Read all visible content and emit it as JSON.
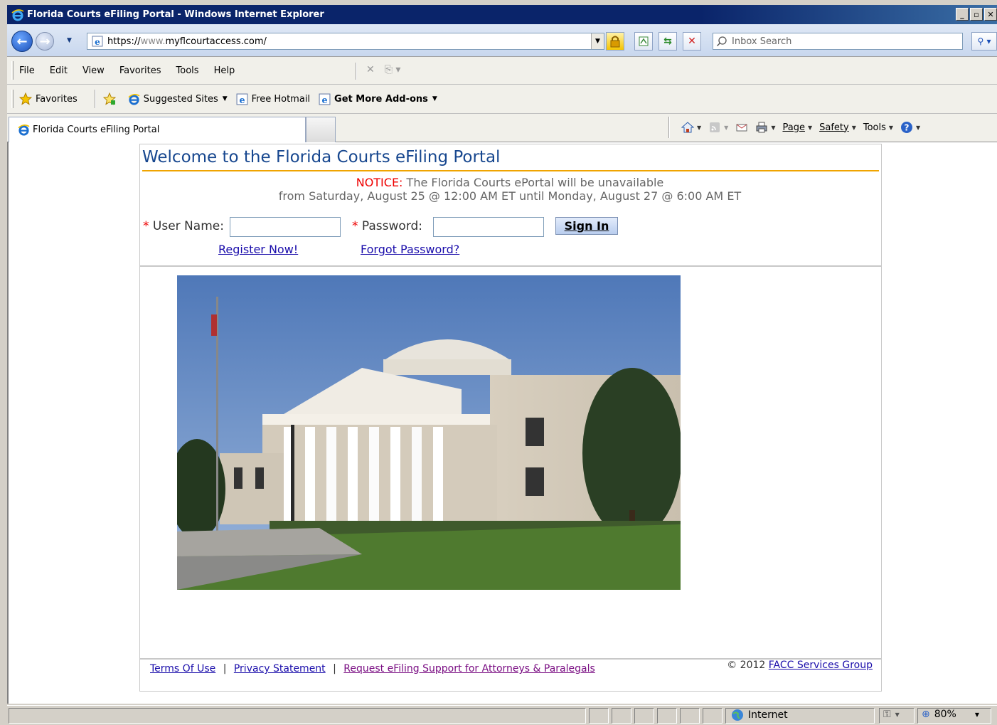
{
  "window": {
    "title": "Florida Courts eFiling Portal - Windows Internet Explorer"
  },
  "address": {
    "url_scheme": "https://",
    "url_host": "www.",
    "url_domain": "myflcourtaccess.com/",
    "search_placeholder": "Inbox Search"
  },
  "menu": {
    "items": [
      "File",
      "Edit",
      "View",
      "Favorites",
      "Tools",
      "Help"
    ]
  },
  "favorites": {
    "favorites_label": "Favorites",
    "suggested_sites": "Suggested Sites",
    "free_hotmail": "Free Hotmail",
    "get_addons": "Get More Add-ons"
  },
  "tab": {
    "label": "Florida Courts eFiling Portal"
  },
  "command_bar": {
    "page": "Page",
    "safety": "Safety",
    "tools": "Tools"
  },
  "page": {
    "title": "Welcome to the Florida Courts eFiling Portal",
    "notice_label": "NOTICE:",
    "notice_line1": "The Florida Courts ePortal will be unavailable",
    "notice_line2": "from Saturday, August 25 @ 12:00 AM ET until Monday, August 27 @ 6:00 AM ET",
    "username_label": "User Name:",
    "password_label": "Password:",
    "required_mark": "*",
    "sign_in": "Sign In",
    "register": "Register Now!",
    "forgot": "Forgot Password?"
  },
  "footer": {
    "terms": "Terms Of Use",
    "divider": "|",
    "privacy": "Privacy Statement",
    "request_support": "Request eFiling Support for Attorneys & Paralegals",
    "copyright": "© 2012",
    "facc": "FACC Services Group"
  },
  "status": {
    "zone": "Internet",
    "zoom": "80%"
  },
  "colors": {
    "title_blue": "#17478f",
    "rule_orange": "#f0a400",
    "notice_red": "#ee0000",
    "link_blue": "#1a0dab"
  }
}
